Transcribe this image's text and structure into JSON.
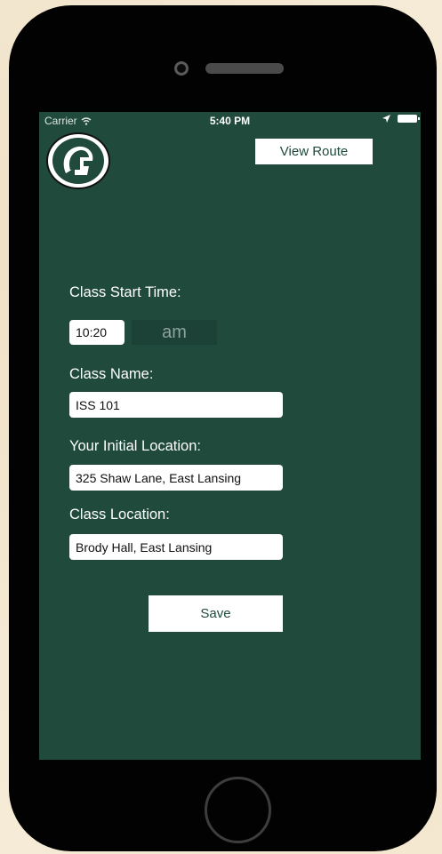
{
  "status_bar": {
    "carrier": "Carrier",
    "time": "5:40 PM"
  },
  "header": {
    "logo_icon": "spartan-helmet-icon",
    "view_route_label": "View Route"
  },
  "form": {
    "start_time_label": "Class Start Time:",
    "start_time_value": "10:20",
    "ampm_value": "am",
    "class_name_label": "Class Name:",
    "class_name_value": "ISS 101",
    "initial_location_label": "Your Initial Location:",
    "initial_location_value": "325 Shaw Lane, East Lansing",
    "class_location_label": "Class Location:",
    "class_location_value": "Brody Hall, East Lansing",
    "save_label": "Save"
  },
  "colors": {
    "screen_bg": "#1f4a3c",
    "accent": "#ffffff"
  }
}
